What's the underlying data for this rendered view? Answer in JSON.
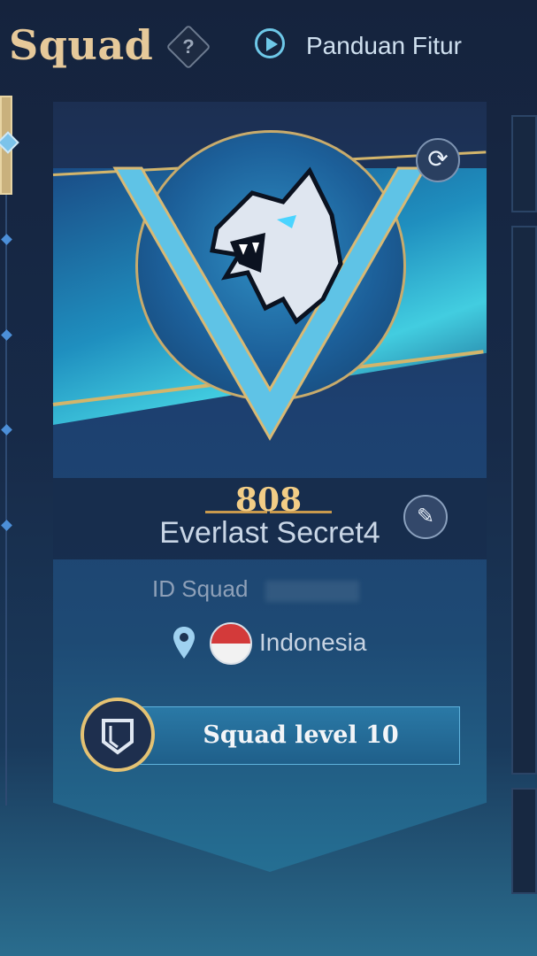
{
  "header": {
    "title": "Squad",
    "help_icon": "question-diamond-icon",
    "guide_label": "Panduan Fitur"
  },
  "squad": {
    "points": "808",
    "name": "Everlast Secret4",
    "id_label": "ID Squad",
    "country": "Indonesia",
    "level_label": "Squad level 10"
  },
  "colors": {
    "accent_gold": "#e6c99a",
    "accent_cyan": "#6ec8e8",
    "level_bar": "#2a79a6"
  },
  "icons": {
    "refresh": "refresh-icon",
    "edit": "pencil-icon",
    "location": "location-pin-icon",
    "flag": "indonesia-flag-icon",
    "badge": "shield-badge-icon",
    "emblem": "wolf-emblem-icon"
  }
}
